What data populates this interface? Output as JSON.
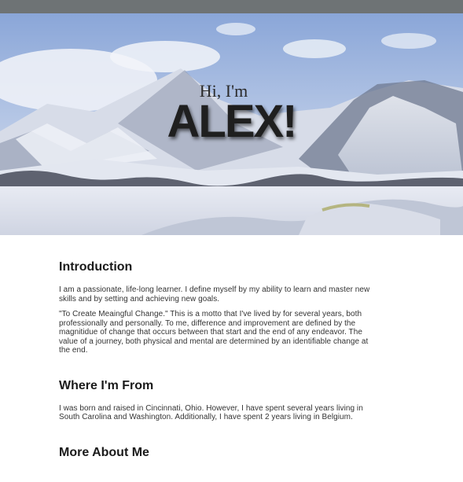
{
  "hero": {
    "greeting": "Hi, I'm",
    "name": "ALEX!"
  },
  "sections": [
    {
      "heading": "Introduction",
      "paragraphs": [
        "I am a passionate, life-long learner. I define myself by my ability to learn and master new skills and by setting and achieving new goals.",
        "\"To Create Meaingful Change.\" This is a motto that I've lived by for several years, both professionally and personally. To me, difference and improvement are defined by the magnitidue of change that occurs between that start and the end of any endeavor. The value of a journey, both physical and mental are determined by an identifiable change at the end."
      ]
    },
    {
      "heading": "Where I'm From",
      "paragraphs": [
        "I was born and raised in Cincinnati, Ohio. However, I have spent several years living in South Carolina and Washington. Additionally, I have spent 2 years living in Belgium."
      ]
    },
    {
      "heading": "More About Me",
      "paragraphs": []
    }
  ]
}
